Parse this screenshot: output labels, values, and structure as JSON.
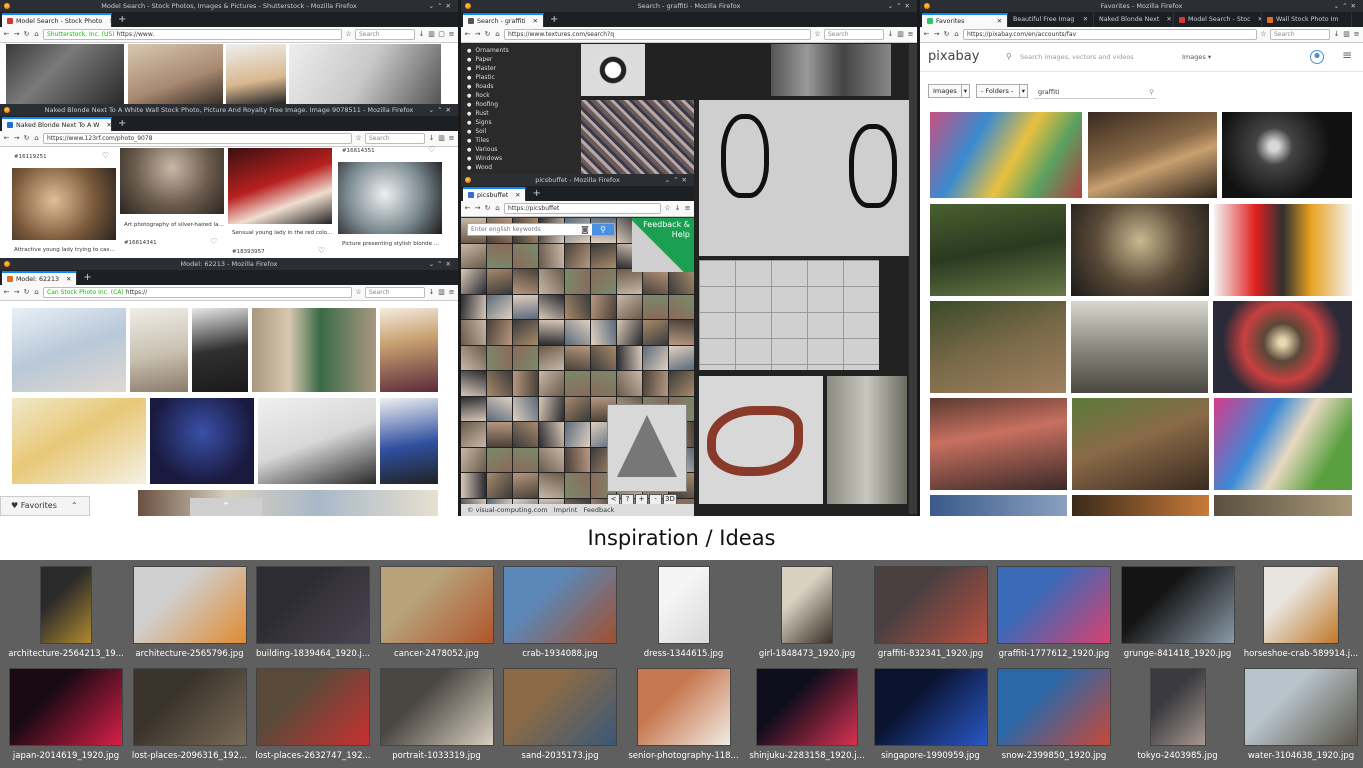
{
  "windows": {
    "shutterstock": {
      "title": "Model Search - Stock Photos, Images & Pictures - Shutterstock - Mozilla Firefox",
      "tab": "Model Search - Stock Photo",
      "url_secure": "Shutterstock, Inc. (US)",
      "url": "https://www.",
      "search_placeholder": "Search"
    },
    "rf123": {
      "title": "Naked Blonde Next To A White Wall Stock Photo, Picture And Royalty Free Image. Image 9078511 - Mozilla Firefox",
      "tab": "Naked Blonde Next To A W",
      "url": "https://www.123rf.com/photo_9078",
      "search_placeholder": "Search",
      "items": [
        {
          "id": "#16119251",
          "caption": "Attractive young lady trying to cas..."
        },
        {
          "id": "#16614341",
          "caption": "Art photography of silver-haired la..."
        },
        {
          "id": "#18393957",
          "caption": "Sensual young lady in the red colo..."
        },
        {
          "id": "#16614351",
          "caption": "Picture presenting stylish blonde ..."
        }
      ]
    },
    "canstock": {
      "title": "Model: 62213 - Mozilla Firefox",
      "tab": "Model: 62213",
      "url_secure": "Can Stock Photo Inc. (CA)",
      "url": "https://",
      "search_placeholder": "Search",
      "favorites": "Favorites"
    },
    "textures": {
      "title": "Search - graffiti - Mozilla Firefox",
      "tab": "Search - graffiti",
      "url": "https://www.textures.com/search?q",
      "search_placeholder": "Search",
      "categories": [
        "Ornaments",
        "Paper",
        "Plaster",
        "Plastic",
        "Roads",
        "Rock",
        "Roofing",
        "Rust",
        "Signs",
        "Soil",
        "Tiles",
        "Various",
        "Windows",
        "Wood"
      ]
    },
    "picsbuffet": {
      "title": "picsbuffet - Mozilla Firefox",
      "tab": "picsbuffet",
      "url": "https://picsbuffet",
      "search_placeholder": "Enter english keywords",
      "feedback": "Feedback & Help",
      "footer_credit": "© visual-computing.com",
      "footer_imprint": "Imprint",
      "footer_feedback": "Feedback",
      "zoom_buttons": [
        "<",
        "?",
        "+",
        "-",
        "3D"
      ]
    },
    "pixabay": {
      "title": "Favorites - Mozilla Firefox",
      "tabs": [
        "Favorites",
        "Beautiful Free Imag",
        "Naked Blonde Next",
        "Model Search - Stoc",
        "Wall Stock Photo Im"
      ],
      "url": "https://pixabay.com/en/accounts/fav",
      "search_placeholder": "Search",
      "logo": "pixabay",
      "site_search_placeholder": "Search images, vectors and videos",
      "images_dropdown": "Images",
      "filter_images": "Images",
      "filter_folders": "- Folders -",
      "filter_query": "graffiti"
    }
  },
  "inspiration_title": "Inspiration / Ideas",
  "file_manager": {
    "row1": [
      {
        "name": "architecture-2564213_19...",
        "w": 52,
        "c1": "#2a2a2a",
        "c2": "#b08a30"
      },
      {
        "name": "architecture-2565796.jpg",
        "w": 114,
        "c1": "#cfcfcf",
        "c2": "#e08a30"
      },
      {
        "name": "building-1839464_1920.j...",
        "w": 114,
        "c1": "#2e2c33",
        "c2": "#4a4552"
      },
      {
        "name": "cancer-2478052.jpg",
        "w": 114,
        "c1": "#b8a27a",
        "c2": "#b0552a"
      },
      {
        "name": "crab-1934088.jpg",
        "w": 114,
        "c1": "#5c88b8",
        "c2": "#a05030"
      },
      {
        "name": "dress-1344615.jpg",
        "w": 52,
        "c1": "#f4f4f4",
        "c2": "#d8d8d8"
      },
      {
        "name": "girl-1848473_1920.jpg",
        "w": 52,
        "c1": "#d8d0c0",
        "c2": "#3a3028"
      },
      {
        "name": "graffiti-832341_1920.jpg",
        "w": 114,
        "c1": "#4a4040",
        "c2": "#b85040"
      },
      {
        "name": "graffiti-1777612_1920.jpg",
        "w": 114,
        "c1": "#3a6ab8",
        "c2": "#d84070"
      },
      {
        "name": "grunge-841418_1920.jpg",
        "w": 114,
        "c1": "#141414",
        "c2": "#8a9aa8"
      },
      {
        "name": "horseshoe-crab-589914.j...",
        "w": 76,
        "c1": "#e8e4de",
        "c2": "#c07828"
      }
    ],
    "row2": [
      {
        "name": "japan-2014619_1920.jpg",
        "w": 114,
        "c1": "#1a0a14",
        "c2": "#d82048"
      },
      {
        "name": "lost-places-2096316_192...",
        "w": 114,
        "c1": "#3a342c",
        "c2": "#7a6a58"
      },
      {
        "name": "lost-places-2632747_192...",
        "w": 114,
        "c1": "#5a4a3a",
        "c2": "#c83030"
      },
      {
        "name": "portrait-1033319.jpg",
        "w": 114,
        "c1": "#4a4642",
        "c2": "#d8d0c0"
      },
      {
        "name": "sand-2035173.jpg",
        "w": 114,
        "c1": "#8a6a48",
        "c2": "#3a5878"
      },
      {
        "name": "senior-photography-118...",
        "w": 94,
        "c1": "#c87850",
        "c2": "#f0ece4"
      },
      {
        "name": "shinjuku-2283158_1920.j...",
        "w": 102,
        "c1": "#0e0e1c",
        "c2": "#d83050"
      },
      {
        "name": "singapore-1990959.jpg",
        "w": 114,
        "c1": "#0a1430",
        "c2": "#2a58c8"
      },
      {
        "name": "snow-2399850_1920.jpg",
        "w": 114,
        "c1": "#2a68a8",
        "c2": "#c84838"
      },
      {
        "name": "tokyo-2403985.jpg",
        "w": 56,
        "c1": "#3a3a40",
        "c2": "#a89890"
      },
      {
        "name": "water-3104638_1920.jpg",
        "w": 114,
        "c1": "#b8c4cc",
        "c2": "#5a5448"
      }
    ]
  }
}
